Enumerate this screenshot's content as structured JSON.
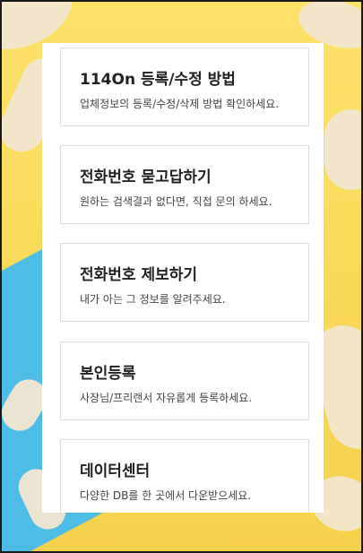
{
  "menu": {
    "items": [
      {
        "title": "114On 등록/수정 방법",
        "description": "업체정보의 등록/수정/삭제 방법 확인하세요."
      },
      {
        "title": "전화번호 묻고답하기",
        "description": "원하는 검색결과 없다면, 직접 문의 하세요."
      },
      {
        "title": "전화번호 제보하기",
        "description": "내가 아는 그 정보를 알려주세요."
      },
      {
        "title": "본인등록",
        "description": "사장님/프리랜서 자유롭게 등록하세요."
      },
      {
        "title": "데이터센터",
        "description": "다양한 DB를 한 곳에서 다운받으세요."
      }
    ]
  },
  "colors": {
    "background_yellow": "#fde26a",
    "background_blue": "#4dbde6",
    "card_border": "#dcdcdc",
    "title_text": "#222222"
  }
}
